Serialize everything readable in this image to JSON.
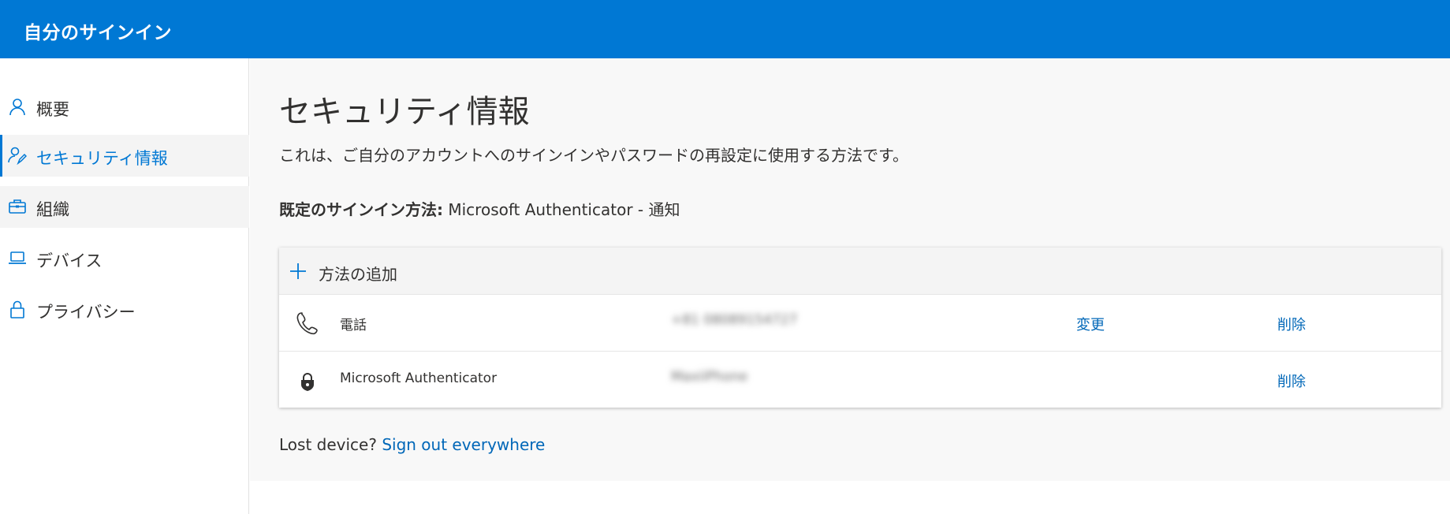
{
  "header": {
    "title": "自分のサインイン"
  },
  "sidebar": {
    "items": [
      {
        "label": "概要",
        "icon": "person-icon"
      },
      {
        "label": "セキュリティ情報",
        "icon": "person-key-icon",
        "active": true
      },
      {
        "label": "組織",
        "icon": "briefcase-icon"
      },
      {
        "label": "デバイス",
        "icon": "laptop-icon"
      },
      {
        "label": "プライバシー",
        "icon": "lock-icon"
      }
    ]
  },
  "main": {
    "title": "セキュリティ情報",
    "description": "これは、ご自分のアカウントへのサインインやパスワードの再設定に使用する方法です。",
    "default_method_label": "既定のサインイン方法:",
    "default_method_value": "Microsoft Authenticator - 通知",
    "add_method_label": "方法の追加",
    "methods": [
      {
        "name": "電話",
        "icon": "phone-icon",
        "value": "+81 08089154727",
        "change": "変更",
        "delete": "削除"
      },
      {
        "name": "Microsoft Authenticator",
        "icon": "authenticator-lock-icon",
        "value": "MaxiiPhone",
        "delete": "削除"
      }
    ],
    "lost_device_text": "Lost device?",
    "sign_out_link": "Sign out everywhere"
  },
  "colors": {
    "accent": "#0078d4",
    "link": "#0067b8",
    "page_bg": "#f8f8f8"
  }
}
